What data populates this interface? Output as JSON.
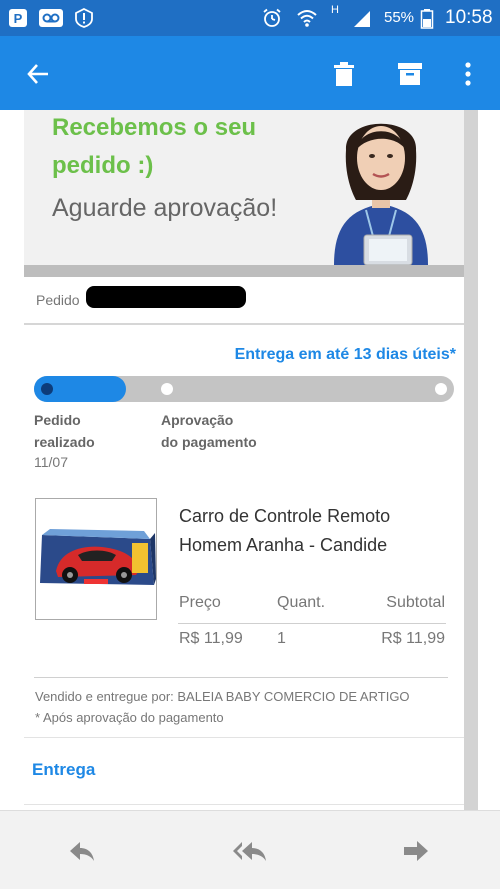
{
  "status_bar": {
    "battery_percent": "55%",
    "time": "10:58",
    "network_letter": "H"
  },
  "app_bar": {
    "icons": [
      "back-arrow-icon",
      "trash-icon",
      "archive-icon",
      "more-vert-icon"
    ]
  },
  "email": {
    "banner": {
      "line1": "Recebemos o seu",
      "line2": "pedido :)",
      "line3": "Aguarde aprovação!"
    },
    "order_label": "Pedido",
    "delivery_estimate": "Entrega em até 13 dias úteis*",
    "progress": {
      "fraction": 0.22,
      "steps": [
        {
          "line1": "Pedido",
          "line2": "realizado",
          "date": "11/07"
        },
        {
          "line1": "Aprovação",
          "line2": "do pagamento"
        }
      ]
    },
    "product": {
      "name_line1": "Carro de Controle Remoto",
      "name_line2": "Homem Aranha - Candide",
      "headers": {
        "price": "Preço",
        "qty": "Quant.",
        "subtotal": "Subtotal"
      },
      "values": {
        "price": "R$ 11,99",
        "qty": "1",
        "subtotal": "R$ 11,99"
      }
    },
    "seller": "Vendido e entregue por: BALEIA BABY COMERCIO DE ARTIGO",
    "note": "* Após aprovação do pagamento",
    "section_entrega": "Entrega"
  },
  "colors": {
    "primary": "#1e88e5",
    "green": "#6cc04a",
    "status_bar": "#1f6fc4"
  }
}
